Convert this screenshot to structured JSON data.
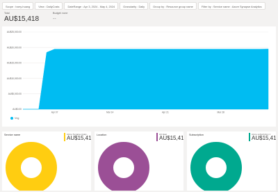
{
  "filters": [
    "Scope : harry-huang",
    "View : DailyCosts",
    "DateRange : Apr 3, 2024 - May 4, 2024",
    "Granularity : Daily",
    "Group by : Resource group name",
    "Filter by : Service name : Azure Synapse Analytics"
  ],
  "kpis": {
    "total": {
      "label": "Total",
      "value": "AU$15,418"
    },
    "budget": {
      "label": "Budget: none",
      "value": "--"
    }
  },
  "chart_data": {
    "type": "area",
    "x": [
      "Apr 3",
      "Apr 4",
      "Apr 5",
      "Apr 6",
      "Apr 7",
      "Apr 8",
      "Apr 9",
      "Apr 10",
      "Apr 11",
      "Apr 12",
      "Apr 13",
      "Apr 14",
      "Apr 15",
      "Apr 16",
      "Apr 17",
      "Apr 18",
      "Apr 19",
      "Apr 20",
      "Apr 21",
      "Apr 22",
      "Apr 23",
      "Apr 24",
      "Apr 25",
      "Apr 26",
      "Apr 27",
      "Apr 28",
      "Apr 29",
      "Apr 30",
      "May 1",
      "May 2",
      "May 3",
      "May 4"
    ],
    "series": [
      {
        "name": "",
        "values": [
          0,
          0,
          0,
          18400,
          19450,
          19450,
          19450,
          19450,
          19450,
          19450,
          19450,
          19450,
          19450,
          19450,
          19450,
          19450,
          19450,
          19450,
          19450,
          19450,
          19450,
          19450,
          19450,
          19450,
          19450,
          19450,
          19450,
          19450,
          19450,
          19450,
          19450,
          19500
        ]
      }
    ],
    "ylim": [
      0,
      25000
    ],
    "yticks": [
      "AU$0.00",
      "AU$5,000.00",
      "AU$10,000.00",
      "AU$15,000.00",
      "AU$20,000.00",
      "AU$25,000.00"
    ],
    "xticks": [
      {
        "label": "Apr 07",
        "index": 4
      },
      {
        "label": "Mar 14",
        "index": 11
      },
      {
        "label": "Apr 21",
        "index": 18
      },
      {
        "label": "Mar 28",
        "index": 25
      }
    ],
    "legend": [
      "Vng"
    ],
    "grid": true,
    "color": "#00bcf2"
  },
  "donuts": [
    {
      "title": "Service name",
      "legend_name": "Azure Synapse Analy...",
      "value": "AU$15,418",
      "color": "#ffcd11"
    },
    {
      "title": "Location",
      "legend_name": "AU East",
      "value": "AU$15,418",
      "color": "#9b4f96"
    },
    {
      "title": "Subscription",
      "legend_name": "Azure subscription 1",
      "value": "AU$15,418",
      "color": "#00a98f"
    }
  ]
}
